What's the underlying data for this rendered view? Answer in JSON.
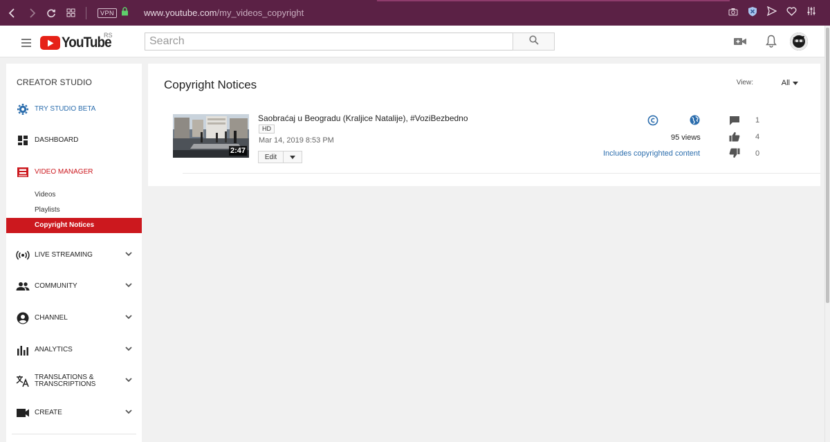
{
  "browser": {
    "url_host": "www.youtube.com",
    "url_path": "/my_videos_copyright",
    "vpn_label": "VPN"
  },
  "header": {
    "logo_text": "YouTube",
    "logo_region": "RS",
    "search_placeholder": "Search"
  },
  "sidebar": {
    "title": "CREATOR STUDIO",
    "try_beta": "TRY STUDIO BETA",
    "dashboard": "DASHBOARD",
    "video_manager": "VIDEO MANAGER",
    "sub_items": [
      "Videos",
      "Playlists",
      "Copyright Notices"
    ],
    "live_streaming": "LIVE STREAMING",
    "community": "COMMUNITY",
    "channel": "CHANNEL",
    "analytics": "ANALYTICS",
    "translations_1": "TRANSLATIONS &",
    "translations_2": "TRANSCRIPTIONS",
    "create": "CREATE"
  },
  "main": {
    "title": "Copyright Notices",
    "view_label": "View:",
    "view_value": "All",
    "video": {
      "title": "Saobraćaj u Beogradu (Kraljice Natalije), #VoziBezbedno",
      "badge": "HD",
      "date": "Mar 14, 2019 8:53 PM",
      "duration": "2:47",
      "edit_label": "Edit",
      "views": "95 views",
      "copyright_note": "Includes copyrighted content",
      "comments": "1",
      "likes": "4",
      "dislikes": "0"
    }
  },
  "colors": {
    "browser_bar": "#5b2145",
    "accent_red": "#cc181e",
    "link_blue": "#2b6dad"
  }
}
